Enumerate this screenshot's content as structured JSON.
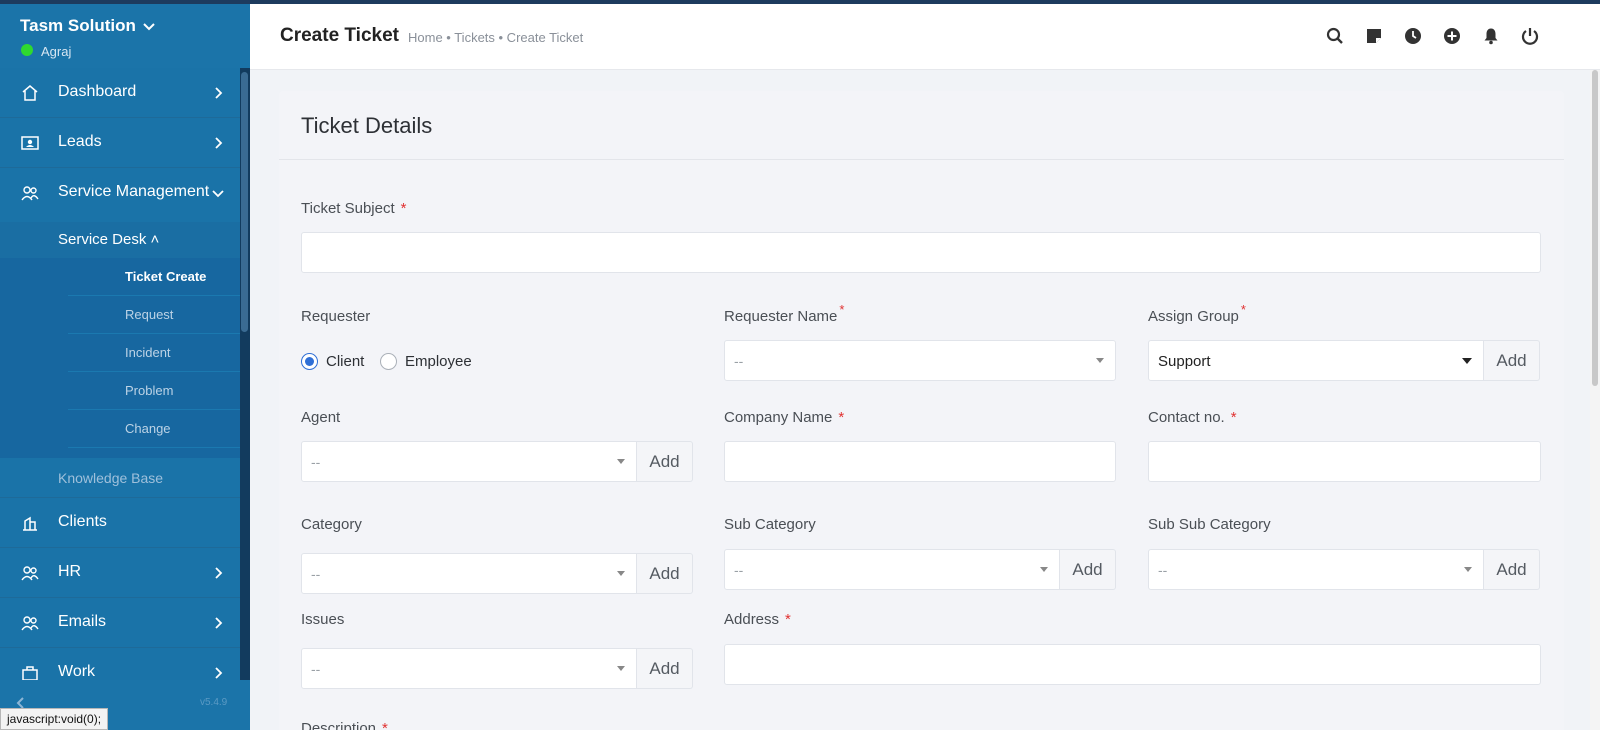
{
  "sidebar": {
    "brand": "Tasm Solution",
    "user": "Agraj",
    "nav": [
      {
        "label": "Dashboard"
      },
      {
        "label": "Leads"
      },
      {
        "label": "Service Management"
      }
    ],
    "service_desk": "Service Desk ˄",
    "sub_items": [
      "Ticket Create",
      "Request",
      "Incident",
      "Problem",
      "Change"
    ],
    "knowledge_base": "Knowledge Base",
    "nav_bottom": [
      {
        "label": "Clients"
      },
      {
        "label": "HR"
      },
      {
        "label": "Emails"
      },
      {
        "label": "Work"
      }
    ],
    "version": "v5.4.9"
  },
  "status_tip": "javascript:void(0);",
  "header": {
    "title": "Create Ticket",
    "breadcrumb": "Home • Tickets • Create Ticket",
    "icons": [
      "search-icon",
      "sticky-note-icon",
      "clock-icon",
      "add-circle-icon",
      "bell-icon",
      "power-icon"
    ]
  },
  "form": {
    "card_title": "Ticket Details",
    "ticket_subject_label": "Ticket Subject",
    "requester_label": "Requester",
    "requester_options": [
      "Client",
      "Employee"
    ],
    "requester_selected": "Client",
    "requester_name_label": "Requester Name",
    "requester_name_value": "--",
    "assign_group_label": "Assign Group",
    "assign_group_value": "Support",
    "agent_label": "Agent",
    "agent_value": "--",
    "company_name_label": "Company Name",
    "contact_label": "Contact no.",
    "category_label": "Category",
    "category_value": "--",
    "sub_category_label": "Sub Category",
    "sub_category_value": "--",
    "sub_sub_category_label": "Sub Sub Category",
    "sub_sub_category_value": "--",
    "issues_label": "Issues",
    "issues_value": "--",
    "address_label": "Address",
    "description_label": "Description",
    "add_label": "Add",
    "required_mark": "*"
  },
  "colors": {
    "sidebar": "#1a73a8",
    "sidebar_sub": "#1767a0",
    "accent": "#2f6fd6",
    "required": "#e03131"
  }
}
